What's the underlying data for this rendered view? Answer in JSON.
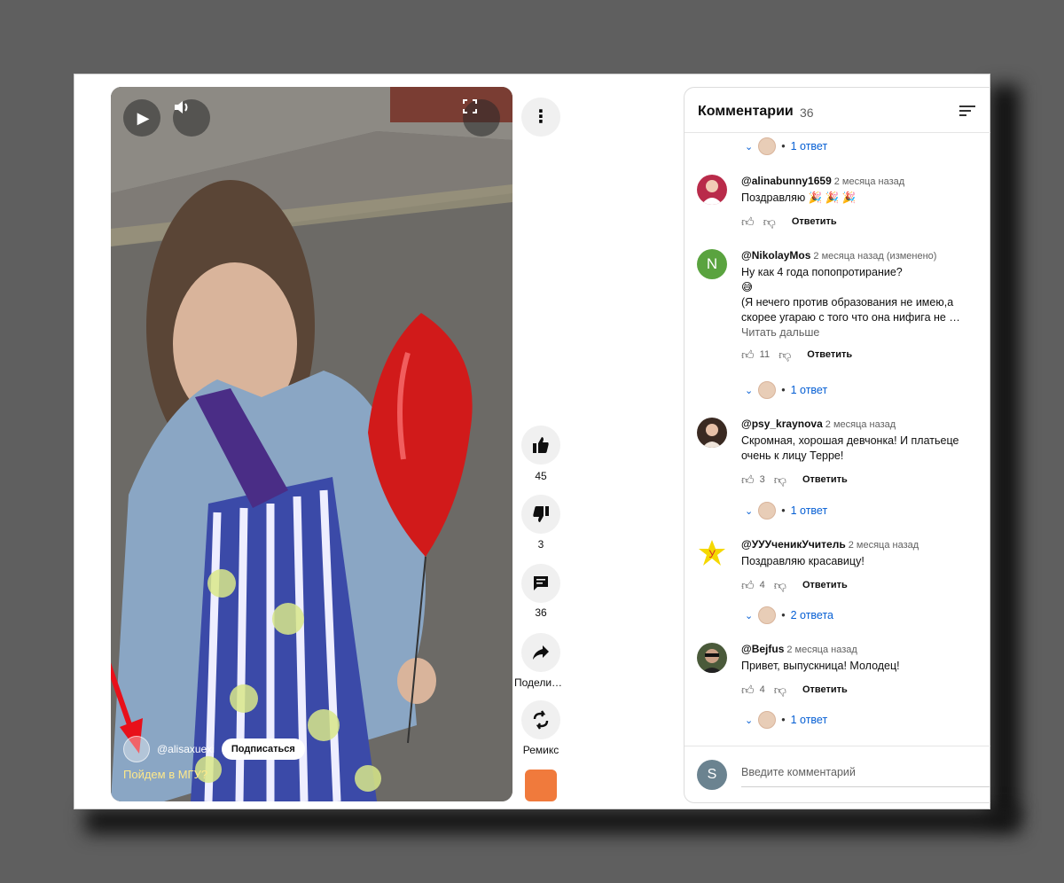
{
  "video": {
    "channel": "@alisaxuexi",
    "subscribe_label": "Подписаться",
    "caption": "Пойдем в МГУ?"
  },
  "rail": {
    "likes": "45",
    "dislikes": "3",
    "comments": "36",
    "share_label": "Поделиться",
    "remix_label": "Ремикс"
  },
  "comments_panel": {
    "title": "Комментарии",
    "count": "36",
    "top_reply": "1 ответ",
    "items": [
      {
        "author": "@alinabunny1659",
        "time": "2 месяца назад",
        "text": "Поздравляю 🎉 🎉 🎉",
        "likes": "",
        "reply_label": "Ответить",
        "replies": ""
      },
      {
        "author": "@NikolayMos",
        "time": "2 месяца назад (изменено)",
        "text1": "Ну как 4 года попопротирание?",
        "text2": "😅",
        "text3": "(Я нечего против образования не имею,а",
        "text4": "скорее угараю с того что она нифига не …",
        "more": "Читать дальше",
        "likes": "11",
        "reply_label": "Ответить",
        "replies": "1 ответ",
        "avatar_letter": "N"
      },
      {
        "author": "@psy_kraynova",
        "time": "2 месяца назад",
        "text1": "Скромная, хорошая девчонка! И платьеце",
        "text2": "очень к лицу Терре!",
        "likes": "3",
        "reply_label": "Ответить",
        "replies": "1 ответ"
      },
      {
        "author": "@УУУченикУчитель",
        "time": "2 месяца назад",
        "text": "Поздравляю красавицу!",
        "likes": "4",
        "reply_label": "Ответить",
        "replies": "2 ответа"
      },
      {
        "author": "@Bejfus",
        "time": "2 месяца назад",
        "text": "Привет, выпускница! Молодец!",
        "likes": "4",
        "reply_label": "Ответить",
        "replies": "1 ответ"
      }
    ],
    "input_placeholder": "Введите комментарий",
    "input_avatar_letter": "S"
  },
  "colors": {
    "link": "#065fd4",
    "arrow": "#e8101a",
    "caption": "#ffe98a"
  }
}
